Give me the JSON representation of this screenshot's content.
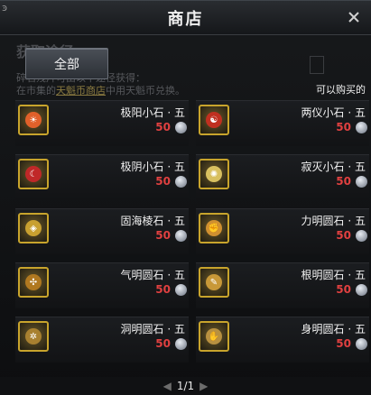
{
  "window": {
    "title": "商店",
    "corner_glyph": "ꜿ"
  },
  "background_text": {
    "heading": "获取途径",
    "line1": "碎石残片可由以下途径获得：",
    "line2_pre": "在市集的",
    "line2_link": "天魁币商店",
    "line2_post": "中用天魁币兑换。"
  },
  "tabs": [
    {
      "label": "全部"
    }
  ],
  "filter_label": "可以购买的",
  "items": [
    {
      "name": "极阳小石 · 五",
      "price": "50",
      "icon": "sun-gem-icon",
      "color": "#e0602a",
      "glyph": "☀"
    },
    {
      "name": "两仪小石 · 五",
      "price": "50",
      "icon": "taiji-gem-icon",
      "color": "#c03020",
      "glyph": "☯"
    },
    {
      "name": "极阴小石 · 五",
      "price": "50",
      "icon": "moon-gem-icon",
      "color": "#c02828",
      "glyph": "☾"
    },
    {
      "name": "寂灭小石 · 五",
      "price": "50",
      "icon": "void-gem-icon",
      "color": "#d8c060",
      "glyph": "✺"
    },
    {
      "name": "固海棱石 · 五",
      "price": "50",
      "icon": "sea-gem-icon",
      "color": "#c8a030",
      "glyph": "◈"
    },
    {
      "name": "力明圆石 · 五",
      "price": "50",
      "icon": "power-gem-icon",
      "color": "#d09030",
      "glyph": "✊"
    },
    {
      "name": "气明圆石 · 五",
      "price": "50",
      "icon": "qi-gem-icon",
      "color": "#b07820",
      "glyph": "✣"
    },
    {
      "name": "根明圆石 · 五",
      "price": "50",
      "icon": "root-gem-icon",
      "color": "#c89838",
      "glyph": "✎"
    },
    {
      "name": "洞明圆石 · 五",
      "price": "50",
      "icon": "insight-gem-icon",
      "color": "#a88030",
      "glyph": "✲"
    },
    {
      "name": "身明圆石 · 五",
      "price": "50",
      "icon": "body-gem-icon",
      "color": "#b89040",
      "glyph": "✋"
    }
  ],
  "pager": {
    "text": "1/1",
    "prev": "◀",
    "next": "▶"
  }
}
